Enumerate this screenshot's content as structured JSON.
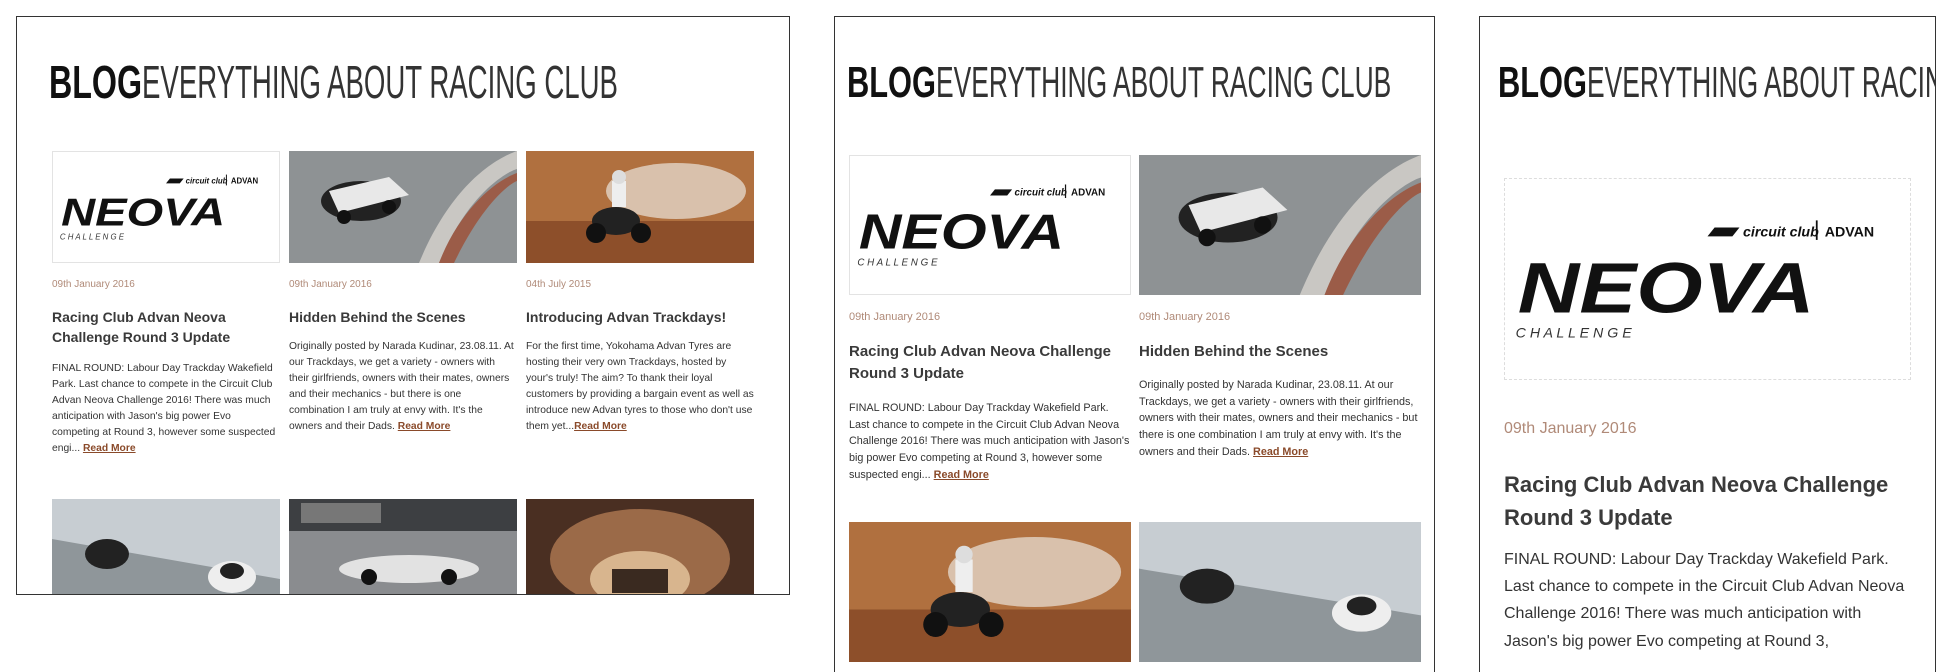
{
  "header": {
    "bold": "BLOG",
    "light": "EVERYTHING ABOUT RACING CLUB"
  },
  "logo": {
    "brand_top": "circuit club",
    "brand_right": "ADVAN",
    "word": "NEOVA",
    "sub": "C H A L L E N G E"
  },
  "read_more": "Read More",
  "posts": [
    {
      "date": "09th January 2016",
      "title": "Racing Club Advan Neova Challenge Round 3 Update",
      "excerpt": "FINAL ROUND: Labour Day Trackday Wakefield Park. Last chance to compete in the Circuit Club Advan Neova Challenge 2016! There was much anticipation with Jason's big power Evo competing at Round 3, however some suspected engi..."
    },
    {
      "date": "09th January 2016",
      "title": "Hidden Behind the Scenes",
      "excerpt": "Originally posted by Narada Kudinar, 23.08.11. At our Trackdays, we get a variety - owners with their girlfriends, owners with their mates, owners and their mechanics - but there is one combination I am truly at envy with. It's the owners and their Dads."
    },
    {
      "date": "04th July 2015",
      "title": "Introducing Advan Trackdays!",
      "excerpt": "For the first time, Yokohama Advan Tyres are hosting their very own Trackdays, hosted by your's truly! The aim? To thank their loyal customers by providing a bargain event as well as introduce new Advan tyres to those who don't use them yet..."
    }
  ],
  "excerpt_f3": "FINAL ROUND: Labour Day Trackday Wakefield Park. Last chance to compete in the Circuit Club Advan Neova Challenge 2016! There was much anticipation with Jason's big power Evo competing at Round 3,",
  "colors": {
    "date": "#b08a78",
    "link": "#8a4a2a",
    "title": "#3a3a3a"
  }
}
